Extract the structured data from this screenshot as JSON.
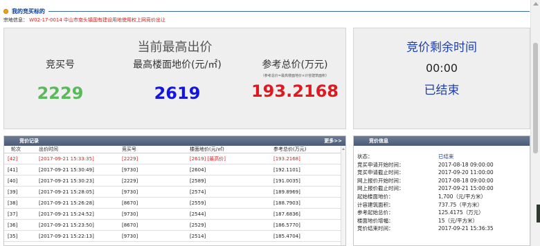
{
  "header": {
    "title": "我的竞买标的",
    "subject_label": "宗地信息：",
    "subject_value": "W02-17-0014 中山市南头镇国有建设用地使用权上网竞价出让"
  },
  "price_panel": {
    "heading": "当前最高出价",
    "bid_no_label": "竞买号",
    "bid_no_value": "2229",
    "floor_price_label": "最高楼面地价(元/㎡)",
    "floor_price_value": "2619",
    "ref_total_label": "参考总价(万元)",
    "ref_total_note": "（参考总价=最高楼面地价×计容建筑面积）",
    "ref_total_value": "193.2168"
  },
  "time_panel": {
    "heading": "竞价剩余时间",
    "remaining": "00:00",
    "status": "已结束"
  },
  "records": {
    "title": "竞价记录",
    "more": "更多>>",
    "columns": [
      "轮次",
      "出价时间",
      "竞买号",
      "楼面地价(元/㎡)",
      "参考总价(万元)"
    ],
    "rows": [
      {
        "round": "[42]",
        "time": "[2017-09-21 15:33:35]",
        "no": "[2229]",
        "price": "[2619] [最高价]",
        "total": "[193.2168]"
      },
      {
        "round": "[41]",
        "time": "[2017-09-21 15:30:49]",
        "no": "[9730]",
        "price": "[2604]",
        "total": "[192.1101]"
      },
      {
        "round": "[40]",
        "time": "[2017-09-21 15:30:23]",
        "no": "[2229]",
        "price": "[2589]",
        "total": "[191.0035]"
      },
      {
        "round": "[39]",
        "time": "[2017-09-21 15:28:05]",
        "no": "[9730]",
        "price": "[2574]",
        "total": "[189.8969]"
      },
      {
        "round": "[38]",
        "time": "[2017-09-21 15:26:28]",
        "no": "[8670]",
        "price": "[2559]",
        "total": "[188.7903]"
      },
      {
        "round": "[37]",
        "time": "[2017-09-21 15:24:52]",
        "no": "[9730]",
        "price": "[2544]",
        "total": "[187.6836]"
      },
      {
        "round": "[36]",
        "time": "[2017-09-21 15:23:50]",
        "no": "[8670]",
        "price": "[2529]",
        "total": "[186.5770]"
      },
      {
        "round": "[35]",
        "time": "[2017-09-21 15:22:13]",
        "no": "[9730]",
        "price": "[2514]",
        "total": "[185.4704]"
      }
    ]
  },
  "info": {
    "title": "竞价信息",
    "items": [
      {
        "key": "状态：",
        "value": "已结束"
      },
      {
        "key": "竞买申请开始时间：",
        "value": "2017-08-18 09:00:00"
      },
      {
        "key": "竞买申请截止时间：",
        "value": "2017-09-20 11:00:00"
      },
      {
        "key": "网上报价开始时间：",
        "value": "2017-08-18 09:00:00"
      },
      {
        "key": "网上报价截止时间：",
        "value": "2017-09-21 15:00:00"
      },
      {
        "key": "起始楼面地价：",
        "value": "1,700（元/平方米）"
      },
      {
        "key": "计容建筑面积：",
        "value": "737.75（平方米）"
      },
      {
        "key": "参考起始总价：",
        "value": "125.4175（万元）"
      },
      {
        "key": "楼面地价增幅：",
        "value": "15（元/平方米）"
      },
      {
        "key": "竞价结束时间：",
        "value": "2017-09-21 15:36:35"
      }
    ]
  },
  "colors": {
    "bid_no": "#5cb85c",
    "floor_price": "#1515e0",
    "ref_total": "#e01820",
    "heading_blue": "#1c3fb0",
    "panel_head": "#56657f"
  },
  "icons": {
    "title_marker": "orange-dot-icon",
    "scroll_up": "scroll-up-arrow-icon"
  }
}
